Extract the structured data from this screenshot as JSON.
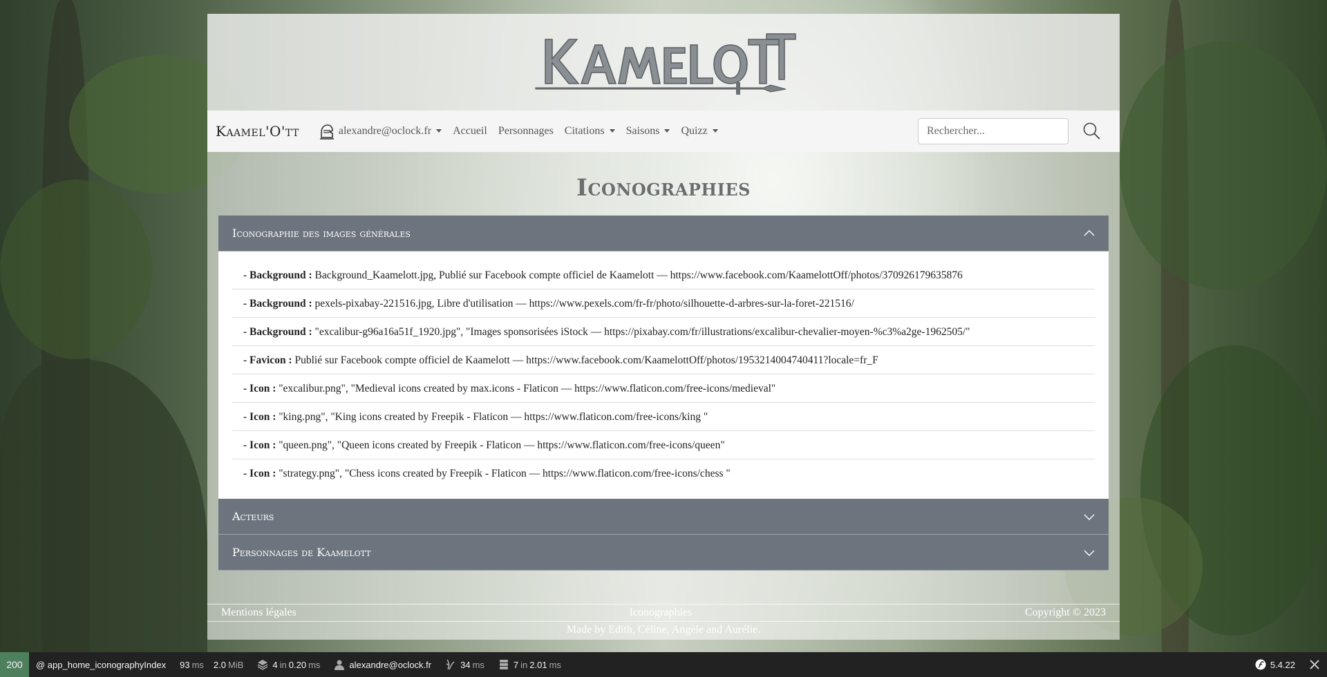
{
  "nav": {
    "brand": "Kaamel'O'tt",
    "user": "alexandre@oclock.fr",
    "items": [
      "Accueil",
      "Personnages",
      "Citations",
      "Saisons",
      "Quizz"
    ],
    "search_placeholder": "Rechercher..."
  },
  "page_title": "Iconographies",
  "accordion": {
    "open_section": {
      "title": "Iconographie des images générales",
      "entries": [
        {
          "label": "- Background :",
          "text": " Background_Kaamelott.jpg, Publié sur Facebook compte officiel de Kaamelott — https://www.facebook.com/KaamelottOff/photos/370926179635876"
        },
        {
          "label": "- Background :",
          "text": " pexels-pixabay-221516.jpg, Libre d'utilisation — https://www.pexels.com/fr-fr/photo/silhouette-d-arbres-sur-la-foret-221516/"
        },
        {
          "label": "- Background :",
          "text": " \"excalibur-g96a16a51f_1920.jpg\", \"Images sponsorisées iStock — https://pixabay.com/fr/illustrations/excalibur-chevalier-moyen-%c3%a2ge-1962505/\""
        },
        {
          "label": "- Favicon :",
          "text": " Publié sur Facebook compte officiel de Kaamelott — https://www.facebook.com/KaamelottOff/photos/1953214004740411?locale=fr_F"
        },
        {
          "label": "- Icon :",
          "text": " \"excalibur.png\", \"Medieval icons created by max.icons - Flaticon — https://www.flaticon.com/free-icons/medieval\""
        },
        {
          "label": "- Icon :",
          "text": " \"king.png\", \"King icons created by Freepik - Flaticon — https://www.flaticon.com/free-icons/king \""
        },
        {
          "label": "- Icon :",
          "text": " \"queen.png\", \"Queen icons created by Freepik - Flaticon — https://www.flaticon.com/free-icons/queen\""
        },
        {
          "label": "- Icon :",
          "text": " \"strategy.png\", \"Chess icons created by Freepik - Flaticon — https://www.flaticon.com/free-icons/chess \""
        }
      ]
    },
    "section2": "Acteurs",
    "section3": "Personnages de Kaamelott"
  },
  "footer": {
    "left": "Mentions légales",
    "center": "Iconographies",
    "right": "Copyright © 2023",
    "made_by": "Made by Edith, Céline, Angèle and Aurélie."
  },
  "debug": {
    "status": "200",
    "route": "@ app_home_iconographyIndex",
    "time_value": "93",
    "time_unit": "ms",
    "memory_value": "2.0",
    "memory_unit": "MiB",
    "forms_count": "4",
    "forms_in": "in",
    "forms_time": "0.20",
    "forms_unit": "ms",
    "user": "alexandre@oclock.fr",
    "twig_value": "34",
    "twig_unit": "ms",
    "db_count": "7",
    "db_in": "in",
    "db_time": "2.01",
    "db_unit": "ms",
    "version": "5.4.22"
  },
  "colors": {
    "accordion_header": "#6c757d",
    "navbar": "#f5f5f5",
    "debug_bar": "#222222",
    "status_ok": "#4f805d"
  }
}
